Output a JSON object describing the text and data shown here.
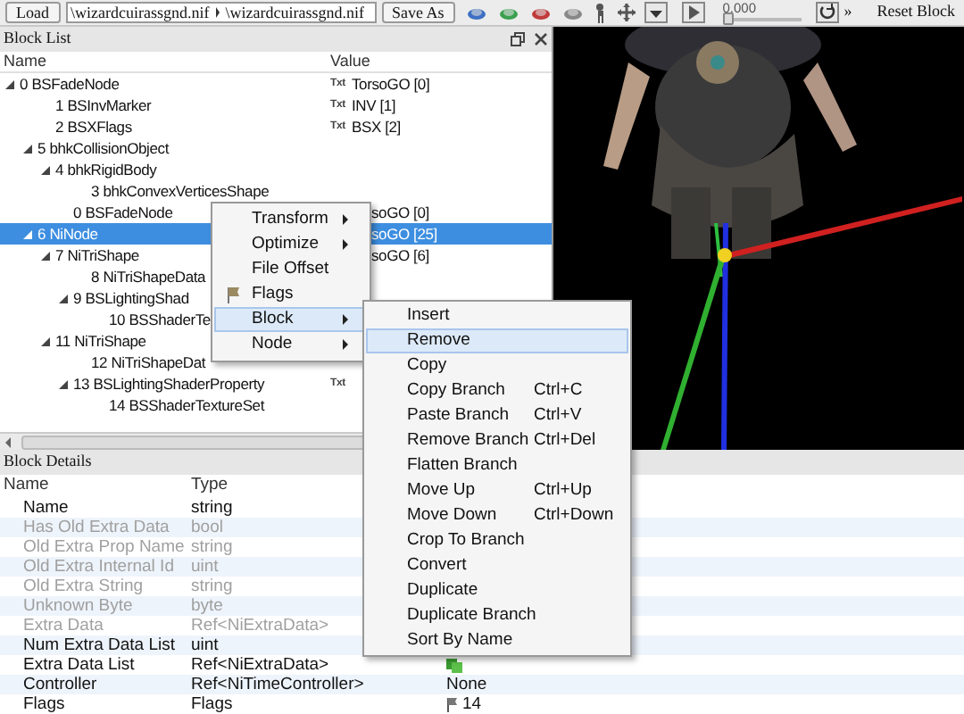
{
  "toolbar": {
    "load_button": "Load",
    "file_path": "\\wizardcuirassgnd.nif",
    "file_path_2": "\\wizardcuirassgnd.nif",
    "save_button": "Save As",
    "time_value": "0.000",
    "time_slider": {
      "level": 0
    },
    "overflow": "»",
    "reset_button": "Reset Block"
  },
  "block_list": {
    "title": "Block List",
    "columns": [
      "Name",
      "Value"
    ],
    "items": [
      {
        "label": "0 BSFadeNode",
        "tag": "Txt",
        "value": "TorsoGO [0]",
        "expanded": true,
        "selected": false,
        "children": [
          {
            "label": "1 BSInvMarker",
            "tag": "Txt",
            "value": "INV [1]",
            "selected": false
          },
          {
            "label": "2 BSXFlags",
            "tag": "Txt",
            "value": "BSX [2]",
            "selected": false
          },
          {
            "label": "5 bhkCollisionObject",
            "expanded": true,
            "selected": false,
            "children": [
              {
                "label": "4 bhkRigidBody",
                "expanded": true,
                "selected": false,
                "children": [
                  {
                    "label": "3 bhkConvexVerticesShape",
                    "selected": false
                  }
                ]
              },
              {
                "label": "0 BSFadeNode",
                "value": "soGO [0]",
                "selected": false
              }
            ]
          },
          {
            "label": "6 NiNode",
            "value": "soGO [25]",
            "expanded": true,
            "selected": true,
            "children": [
              {
                "label": "7 NiTriShape",
                "value": "soGO [6]",
                "expanded": true,
                "selected": false,
                "children": [
                  {
                    "label": "8 NiTriShapeData",
                    "selected": false
                  },
                  {
                    "label": "9 BSLightingShad",
                    "expanded": true,
                    "selected": false,
                    "children": [
                      {
                        "label": "10 BSShaderTe",
                        "selected": false
                      }
                    ]
                  }
                ]
              },
              {
                "label": "11 NiTriShape",
                "expanded": true,
                "selected": false,
                "children": [
                  {
                    "label": "12 NiTriShapeDat",
                    "selected": false
                  },
                  {
                    "label": "13 BSLightingShaderProperty",
                    "tag": "Txt",
                    "expanded": true,
                    "selected": false,
                    "children": [
                      {
                        "label": "14 BSShaderTextureSet",
                        "selected": false
                      }
                    ]
                  }
                ]
              }
            ]
          }
        ]
      }
    ]
  },
  "context_menu": {
    "items": [
      {
        "label": "Transform",
        "submenu": true,
        "selected": false
      },
      {
        "label": "Optimize",
        "submenu": true,
        "selected": false
      },
      {
        "label": "File Offset",
        "submenu": false,
        "selected": false
      },
      {
        "label": "Flags",
        "submenu": false,
        "icon": true,
        "selected": false
      },
      {
        "label": "Block",
        "submenu": true,
        "selected": true
      },
      {
        "label": "Node",
        "submenu": true,
        "selected": false
      }
    ]
  },
  "submenu": {
    "items": [
      {
        "label": "Insert",
        "selected": false
      },
      {
        "label": "Remove",
        "selected": true
      },
      {
        "label": "Copy",
        "selected": false
      },
      {
        "label": "Copy Branch",
        "shortcut": "Ctrl+C",
        "selected": false
      },
      {
        "label": "Paste Branch",
        "shortcut": "Ctrl+V",
        "selected": false
      },
      {
        "label": "Remove Branch",
        "shortcut": "Ctrl+Del",
        "selected": false
      },
      {
        "label": "Flatten Branch",
        "selected": false
      },
      {
        "label": "Move Up",
        "shortcut": "Ctrl+Up",
        "selected": false
      },
      {
        "label": "Move Down",
        "shortcut": "Ctrl+Down",
        "selected": false
      },
      {
        "label": "Crop To Branch",
        "selected": false
      },
      {
        "label": "Convert",
        "selected": false
      },
      {
        "label": "Duplicate",
        "selected": false
      },
      {
        "label": "Duplicate Branch",
        "selected": false
      },
      {
        "label": "Sort By Name",
        "selected": false
      }
    ]
  },
  "block_details": {
    "title": "Block Details",
    "columns": [
      "Name",
      "Type"
    ],
    "rows": [
      {
        "name": "Name",
        "type": "string",
        "kind": "plain",
        "disabled": false
      },
      {
        "name": "Has Old Extra Data",
        "type": "bool",
        "kind": "plain",
        "disabled": true
      },
      {
        "name": "Old Extra Prop Name",
        "type": "string",
        "kind": "plain",
        "disabled": true
      },
      {
        "name": "Old Extra Internal Id",
        "type": "uint",
        "kind": "plain",
        "disabled": true
      },
      {
        "name": "Old Extra String",
        "type": "string",
        "kind": "plain",
        "disabled": true
      },
      {
        "name": "Unknown Byte",
        "type": "byte",
        "kind": "plain",
        "disabled": true
      },
      {
        "name": "Extra Data",
        "type": "Ref<NiExtraData>",
        "kind": "plain",
        "disabled": true
      },
      {
        "name": "Num Extra Data List",
        "type": "uint",
        "kind": "plain",
        "disabled": false
      },
      {
        "name": "Extra Data List",
        "type": "Ref<NiExtraData>",
        "kind": "list",
        "disabled": false
      },
      {
        "name": "Controller",
        "type": "Ref<NiTimeController>",
        "kind": "plain",
        "value": "None",
        "disabled": false
      },
      {
        "name": "Flags",
        "type": "Flags",
        "kind": "flags",
        "value": "14",
        "disabled": false
      }
    ]
  }
}
